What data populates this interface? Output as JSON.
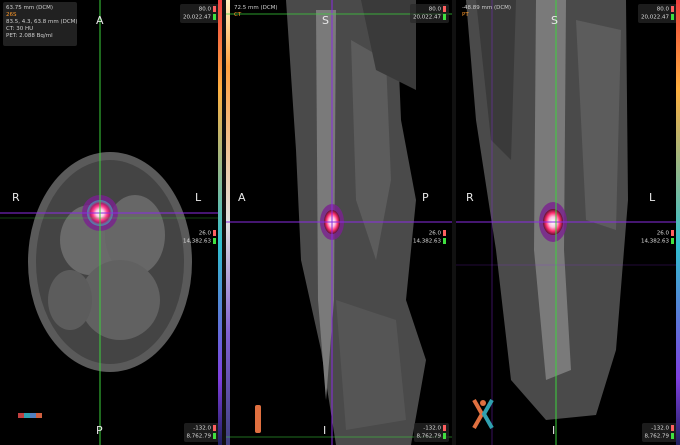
{
  "viewports": {
    "axial": {
      "info_line1": "63.75 mm (DCM)",
      "info_line2": "26S",
      "info_line3": "83.5, 4.3, 63.8 mm (DCM)",
      "info_line4": "CT: 30 HU",
      "info_line5": "PET: 2.088 Bq/ml",
      "orient_top": "A",
      "orient_bottom": "P",
      "orient_left": "R",
      "orient_right": "L",
      "wl_top_1": "80.0",
      "wl_top_2": "20,022.47",
      "wl_mid_1": "26.0",
      "wl_mid_2": "14,382.63",
      "wl_bot_1": "-132.0",
      "wl_bot_2": "8,762.79"
    },
    "sagittal": {
      "info_line1": "72.5 mm (DCM)",
      "info_line2": "CT",
      "orient_top": "S",
      "orient_bottom": "I",
      "orient_left": "A",
      "orient_right": "P",
      "wl_top_1": "80.0",
      "wl_top_2": "20,022.47",
      "wl_mid_1": "26.0",
      "wl_mid_2": "14,382.63",
      "wl_bot_1": "-132.0",
      "wl_bot_2": "8,762.79"
    },
    "coronal": {
      "info_line1": "-48.89 mm (DCM)",
      "info_line2": "PT",
      "orient_top": "S",
      "orient_bottom": "I",
      "orient_left": "R",
      "orient_right": "L",
      "wl_top_1": "80.0",
      "wl_top_2": "20,022.47",
      "wl_mid_1": "26.0",
      "wl_mid_2": "14,382.63",
      "wl_bot_1": "-132.0",
      "wl_bot_2": "8,762.79"
    }
  },
  "colors": {
    "crosshair_green": "#3cd23c",
    "crosshair_purple": "#8a2be2",
    "accent_orange": "#ff9a2a",
    "background": "#000000"
  }
}
